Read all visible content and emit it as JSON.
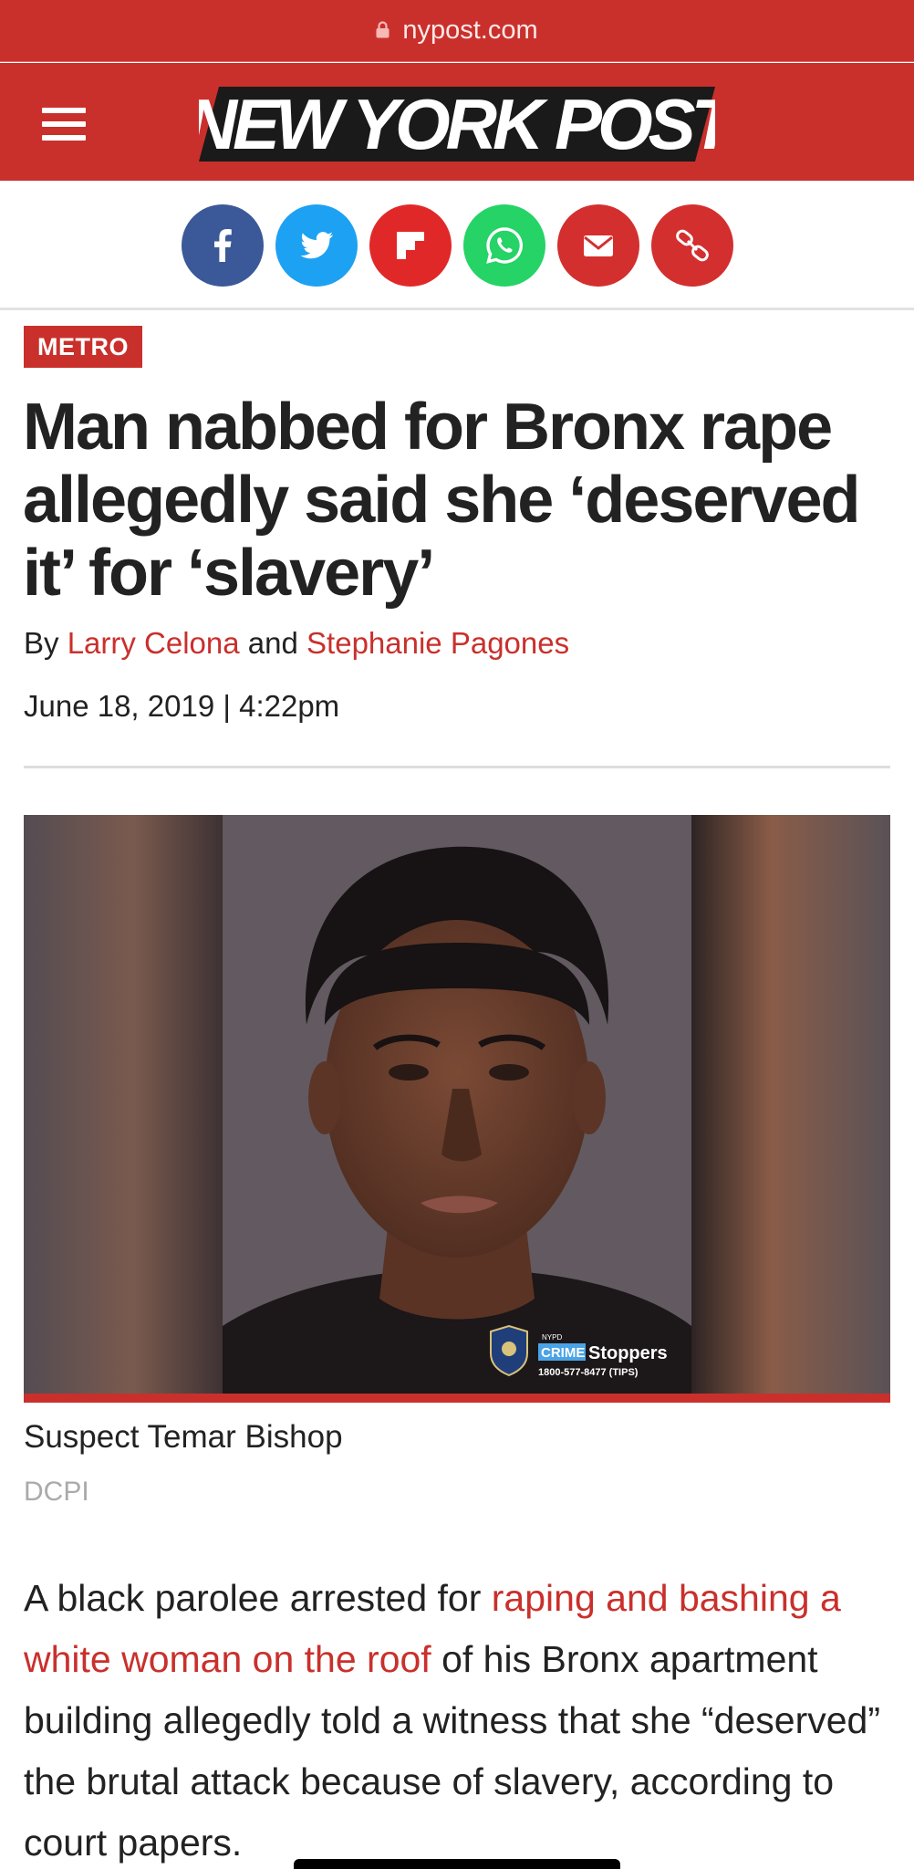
{
  "browser": {
    "url": "nypost.com"
  },
  "header": {
    "logo_text": "NEW YORK POST"
  },
  "share": [
    {
      "name": "facebook",
      "icon": "facebook-icon",
      "color": "#3b5998"
    },
    {
      "name": "twitter",
      "icon": "twitter-icon",
      "color": "#1da1f2"
    },
    {
      "name": "flipboard",
      "icon": "flipboard-icon",
      "color": "#e12828"
    },
    {
      "name": "whatsapp",
      "icon": "whatsapp-icon",
      "color": "#25d366"
    },
    {
      "name": "email",
      "icon": "email-icon",
      "color": "#d32f2f"
    },
    {
      "name": "copy-link",
      "icon": "link-icon",
      "color": "#d32f2f"
    }
  ],
  "article": {
    "section": "METRO",
    "headline": "Man nabbed for Bronx rape allegedly said she ‘deserved it’ for ‘slavery’",
    "byline_prefix": "By",
    "author1": "Larry Celona",
    "byline_and": "and",
    "author2": "Stephanie Pagones",
    "date": "June 18, 2019 | 4:22pm",
    "photo": {
      "overlay_top": "NYPD",
      "overlay_brand1": "CRIME",
      "overlay_brand2": "Stoppers",
      "overlay_phone": "1800-577-8477 (TIPS)"
    },
    "caption": "Suspect Temar Bishop",
    "credit": "DCPI",
    "body": {
      "part1": "A black parolee arrested for ",
      "link": "raping and bashing a white woman on the roof",
      "part2": " of his Bronx apartment building allegedly told a witness that she “deserved” the brutal attack because of slavery, according to court papers."
    }
  },
  "colors": {
    "brand_red": "#c9302c",
    "link_red": "#c9302c"
  }
}
